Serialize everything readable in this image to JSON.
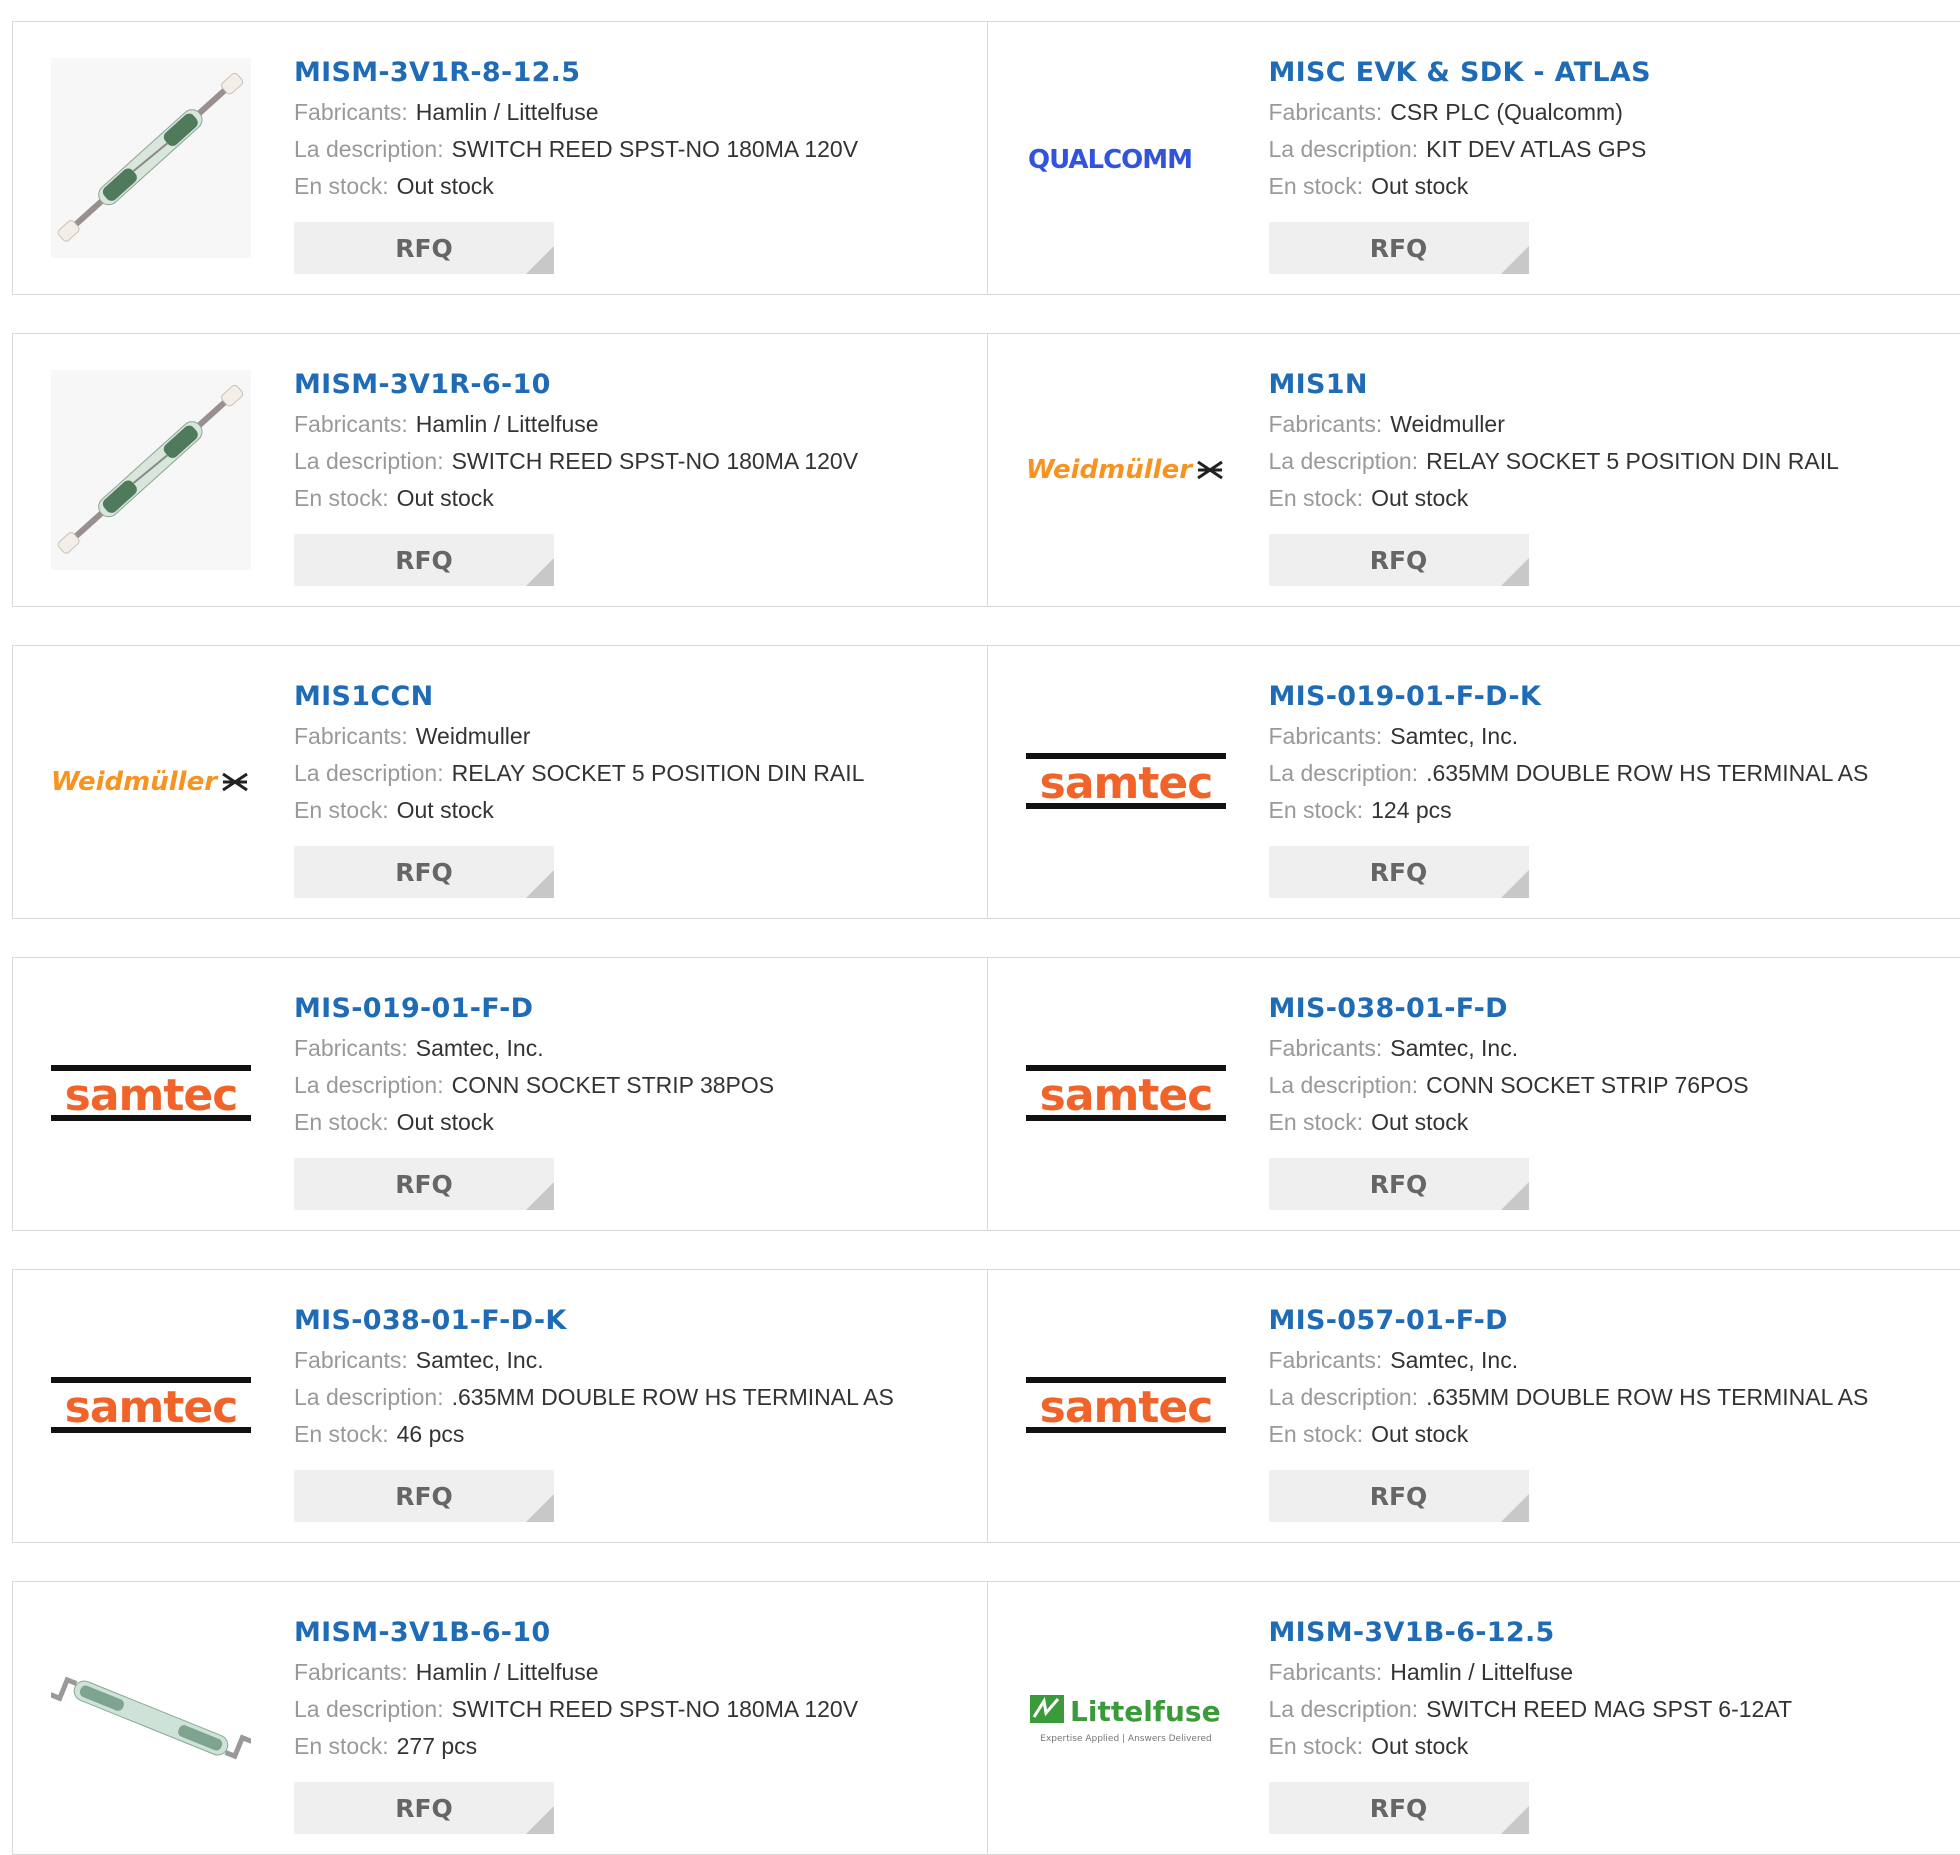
{
  "labels": {
    "manufacturer": "Fabricants:",
    "description": "La description:",
    "stock": "En stock:",
    "rfq": "RFQ"
  },
  "products": [
    {
      "pn": "MISM-3V1R-8-12.5",
      "mfr": "Hamlin / Littelfuse",
      "desc": "SWITCH REED SPST-NO 180MA 120V",
      "stock": "Out stock",
      "image": "reed-switch-icon"
    },
    {
      "pn": "MISC EVK & SDK - ATLAS",
      "mfr": "CSR PLC (Qualcomm)",
      "desc": "KIT DEV ATLAS GPS",
      "stock": "Out stock",
      "image": "qualcomm-logo",
      "logo_text": "QUALCOMM"
    },
    {
      "pn": "MISM-3V1R-6-10",
      "mfr": "Hamlin / Littelfuse",
      "desc": "SWITCH REED SPST-NO 180MA 120V",
      "stock": "Out stock",
      "image": "reed-switch-icon"
    },
    {
      "pn": "MIS1N",
      "mfr": "Weidmuller",
      "desc": "RELAY SOCKET 5 POSITION DIN RAIL",
      "stock": "Out stock",
      "image": "weidmuller-logo",
      "logo_text": "Weidmüller"
    },
    {
      "pn": "MIS1CCN",
      "mfr": "Weidmuller",
      "desc": "RELAY SOCKET 5 POSITION DIN RAIL",
      "stock": "Out stock",
      "image": "weidmuller-logo",
      "logo_text": "Weidmüller"
    },
    {
      "pn": "MIS-019-01-F-D-K",
      "mfr": "Samtec, Inc.",
      "desc": ".635MM DOUBLE ROW HS TERMINAL AS",
      "stock": "124 pcs",
      "image": "samtec-logo",
      "logo_text": "samtec"
    },
    {
      "pn": "MIS-019-01-F-D",
      "mfr": "Samtec, Inc.",
      "desc": "CONN SOCKET STRIP 38POS",
      "stock": "Out stock",
      "image": "samtec-logo",
      "logo_text": "samtec"
    },
    {
      "pn": "MIS-038-01-F-D",
      "mfr": "Samtec, Inc.",
      "desc": "CONN SOCKET STRIP 76POS",
      "stock": "Out stock",
      "image": "samtec-logo",
      "logo_text": "samtec"
    },
    {
      "pn": "MIS-038-01-F-D-K",
      "mfr": "Samtec, Inc.",
      "desc": ".635MM DOUBLE ROW HS TERMINAL AS",
      "stock": "46 pcs",
      "image": "samtec-logo",
      "logo_text": "samtec"
    },
    {
      "pn": "MIS-057-01-F-D",
      "mfr": "Samtec, Inc.",
      "desc": ".635MM DOUBLE ROW HS TERMINAL AS",
      "stock": "Out stock",
      "image": "samtec-logo",
      "logo_text": "samtec"
    },
    {
      "pn": "MISM-3V1B-6-10",
      "mfr": "Hamlin / Littelfuse",
      "desc": "SWITCH REED SPST-NO 180MA 120V",
      "stock": "277 pcs",
      "image": "reed-switch-flat-icon"
    },
    {
      "pn": "MISM-3V1B-6-12.5",
      "mfr": "Hamlin / Littelfuse",
      "desc": "SWITCH REED MAG SPST 6-12AT",
      "stock": "Out stock",
      "image": "littelfuse-logo",
      "logo_text": "Littelfuse",
      "logo_tagline": "Expertise Applied | Answers Delivered"
    }
  ],
  "colors": {
    "link": "#1f6bb5",
    "label": "#999999",
    "value": "#333333",
    "rfq_bg": "#efefef",
    "border": "#d9d9d9",
    "samtec_orange": "#f0642a",
    "weidmuller_orange": "#f7931e",
    "qualcomm_blue": "#3253dc",
    "littelfuse_green": "#3b9b3b"
  }
}
